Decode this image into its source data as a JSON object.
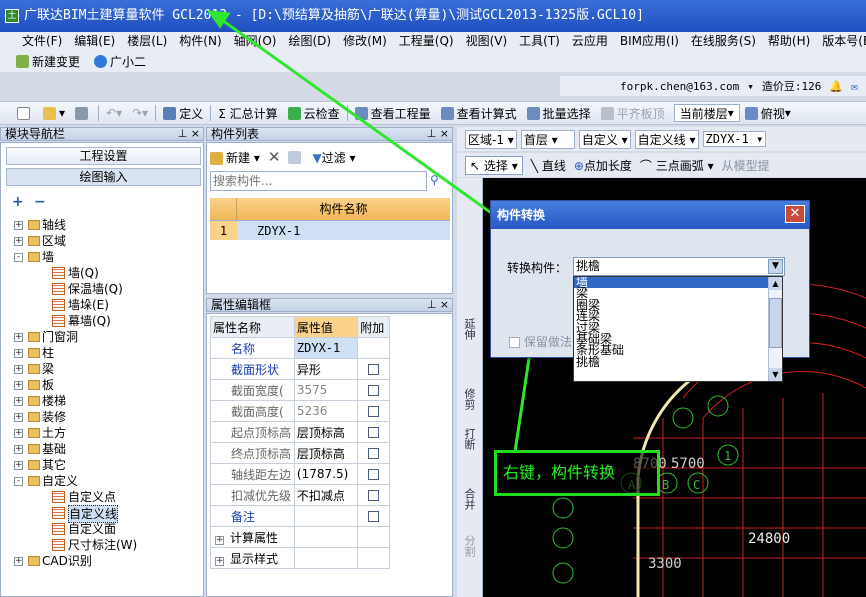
{
  "window": {
    "title": "广联达BIM土建算量软件 GCL2013 - [D:\\预结算及抽筋\\广联达(算量)\\测试GCL2013-1325版.GCL10]",
    "icon_letter": "土"
  },
  "menu": [
    "文件(F)",
    "编辑(E)",
    "楼层(L)",
    "构件(N)",
    "轴网(O)",
    "绘图(D)",
    "修改(M)",
    "工程量(Q)",
    "视图(V)",
    "工具(T)",
    "云应用",
    "BIM应用(I)",
    "在线服务(S)",
    "帮助(H)",
    "版本号(B)"
  ],
  "quick": {
    "new_change": "新建变更",
    "assistant": "广小二"
  },
  "user": {
    "email": "forpk.chen@163.com",
    "beans": "造价豆:126"
  },
  "toolbar": {
    "define": "定义",
    "sum_calc": "Σ 汇总计算",
    "cloud_check": "云检查",
    "view_qty": "查看工程量",
    "view_formula": "查看计算式",
    "batch_select": "批量选择",
    "level_slab": "平齐板顶",
    "current_floor": "当前楼层",
    "view_mode": "俯视"
  },
  "draw_toolbar": {
    "region": "区域-1",
    "floor": "首层",
    "custom": "自定义",
    "custom_line": "自定义线",
    "item": "ZDYX-1",
    "select": "选择",
    "line": "直线",
    "point_length": "点加长度",
    "three_point_arc": "三点画弧",
    "from_model": "从模型提"
  },
  "nav": {
    "title": "模块导航栏",
    "btn_project": "工程设置",
    "btn_draw": "绘图输入"
  },
  "tree": [
    {
      "label": "轴线",
      "level": 0,
      "exp": "+"
    },
    {
      "label": "区域",
      "level": 0,
      "exp": "+"
    },
    {
      "label": "墙",
      "level": 0,
      "exp": "-"
    },
    {
      "label": "墙(Q)",
      "level": 1
    },
    {
      "label": "保温墙(Q)",
      "level": 1
    },
    {
      "label": "墙垛(E)",
      "level": 1
    },
    {
      "label": "幕墙(Q)",
      "level": 1
    },
    {
      "label": "门窗洞",
      "level": 0,
      "exp": "+"
    },
    {
      "label": "柱",
      "level": 0,
      "exp": "+"
    },
    {
      "label": "梁",
      "level": 0,
      "exp": "+"
    },
    {
      "label": "板",
      "level": 0,
      "exp": "+"
    },
    {
      "label": "楼梯",
      "level": 0,
      "exp": "+"
    },
    {
      "label": "装修",
      "level": 0,
      "exp": "+"
    },
    {
      "label": "土方",
      "level": 0,
      "exp": "+"
    },
    {
      "label": "基础",
      "level": 0,
      "exp": "+"
    },
    {
      "label": "其它",
      "level": 0,
      "exp": "+"
    },
    {
      "label": "自定义",
      "level": 0,
      "exp": "-"
    },
    {
      "label": "自定义点",
      "level": 1
    },
    {
      "label": "自定义线",
      "level": 1
    },
    {
      "label": "自定义面",
      "level": 1
    },
    {
      "label": "尺寸标注(W)",
      "level": 1
    },
    {
      "label": "CAD识别",
      "level": 0,
      "exp": "+"
    }
  ],
  "component_list": {
    "title": "构件列表",
    "new": "新建",
    "filter": "过滤",
    "search_placeholder": "搜索构件...",
    "col_name": "构件名称",
    "rows": [
      {
        "idx": "1",
        "name": "ZDYX-1"
      }
    ]
  },
  "property_editor": {
    "title": "属性编辑框",
    "headers": [
      "属性名称",
      "属性值",
      "附加"
    ],
    "rows": [
      {
        "name": "名称",
        "value": "ZDYX-1",
        "check": false
      },
      {
        "name": "截面形状",
        "value": "异形",
        "check": true
      },
      {
        "name": "截面宽度(",
        "value": "3575",
        "check": true
      },
      {
        "name": "截面高度(",
        "value": "5236",
        "check": true
      },
      {
        "name": "起点顶标高",
        "value": "层顶标高",
        "check": true
      },
      {
        "name": "终点顶标高",
        "value": "层顶标高",
        "check": true
      },
      {
        "name": "轴线距左边",
        "value": "(1787.5)",
        "check": true
      },
      {
        "name": "扣减优先级",
        "value": "不扣减点",
        "check": true
      },
      {
        "name": "备注",
        "value": "",
        "check": true
      }
    ],
    "groups": [
      "计算属性",
      "显示样式"
    ]
  },
  "left_tools": [
    "延伸",
    "修剪",
    "打断",
    "合并",
    "分割"
  ],
  "dialog": {
    "title": "构件转换",
    "label": "转换构件：",
    "selected": "挑檐",
    "options": [
      "墙",
      "梁",
      "圈梁",
      "连梁",
      "过梁",
      "基础梁",
      "条形基础",
      "挑檐"
    ],
    "highlighted": "墙",
    "retain_label": "保留做法"
  },
  "callout": {
    "text": "右键，构件转换"
  },
  "cad_labels": [
    "8700",
    "5700",
    "A",
    "B",
    "C",
    "1",
    "2",
    "3",
    "3300",
    "24800"
  ]
}
